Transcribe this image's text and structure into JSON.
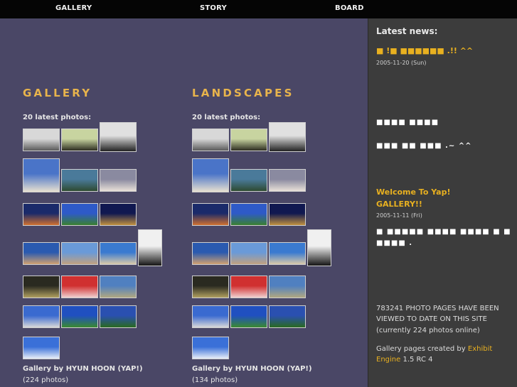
{
  "nav": {
    "items": [
      "GALLERY",
      "STORY",
      "BOARD"
    ]
  },
  "columns": [
    {
      "title": "GALLERY",
      "subtitle": "20 latest photos:",
      "credit_prefix": "Gallery by ",
      "credit_name": "HYUN HOON (YAP!)",
      "count": "(224 photos)"
    },
    {
      "title": "LANDSCAPES",
      "subtitle": "20 latest photos:",
      "credit_prefix": "Gallery by ",
      "credit_name": "HYUN HOON (YAP!)",
      "count": "(134 photos)"
    }
  ],
  "sidebar": {
    "heading": "Latest news:",
    "news": [
      {
        "title": "■ !■ ■■■■■■ .!! ^^",
        "date": "2005-11-20 (Sun)",
        "body": [
          "■■■■ ■■■■",
          "■■■ ■■ ■■■ .~ ^^"
        ]
      },
      {
        "title": "Welcome To Yap! GALLERY!!",
        "date": "2005-11-11 (Fri)",
        "body": [
          "■ ■■■■■ ■■■■ ■■■■ ■ ■",
          "■■■■ ."
        ]
      }
    ],
    "stats": "783241 PHOTO PAGES HAVE BEEN VIEWED TO DATE ON THIS SITE",
    "stats_sub": "(currently 224 photos online)",
    "created_prefix": "Gallery pages created by ",
    "created_link": "Exhibit Engine",
    "created_suffix": " 1.5 RC 4"
  },
  "thumbs": [
    {
      "row": 0,
      "i": 0,
      "icon": "city-bw-photo",
      "colors": [
        "#d8d8d8",
        "#5a5a5a"
      ]
    },
    {
      "row": 0,
      "i": 1,
      "icon": "cafe-photo",
      "colors": [
        "#c8d4a0",
        "#2d2d20"
      ]
    },
    {
      "row": 0,
      "i": 2,
      "icon": "arch-bw-photo",
      "colors": [
        "#e0e0e0",
        "#222222"
      ]
    },
    {
      "row": 1,
      "i": 0,
      "icon": "people-photo",
      "colors": [
        "#4a74c8",
        "#e8e0d0"
      ]
    },
    {
      "row": 1,
      "i": 1,
      "icon": "village-photo",
      "colors": [
        "#4a7a9a",
        "#2e4a30"
      ]
    },
    {
      "row": 1,
      "i": 2,
      "icon": "building-photo",
      "colors": [
        "#8a8aa0",
        "#e8e0d8"
      ]
    },
    {
      "row": 2,
      "i": 0,
      "icon": "night-bridge-photo",
      "colors": [
        "#1a2a6a",
        "#d07030"
      ]
    },
    {
      "row": 2,
      "i": 1,
      "icon": "field-sky-photo",
      "colors": [
        "#2e5ac8",
        "#3a8030"
      ]
    },
    {
      "row": 2,
      "i": 2,
      "icon": "night-museum-photo",
      "colors": [
        "#101850",
        "#c09040"
      ]
    },
    {
      "row": 3,
      "i": 0,
      "icon": "harbor-photo",
      "colors": [
        "#2a5ab0",
        "#d0a070"
      ]
    },
    {
      "row": 3,
      "i": 1,
      "icon": "town-sky-photo",
      "colors": [
        "#6a9ad8",
        "#c0a080"
      ]
    },
    {
      "row": 3,
      "i": 2,
      "icon": "plaza-photo",
      "colors": [
        "#3a7ad0",
        "#d8c8a8"
      ]
    },
    {
      "row": 3,
      "i": 3,
      "icon": "silhouette-bw-photo",
      "colors": [
        "#f0f0f0",
        "#151515"
      ]
    },
    {
      "row": 4,
      "i": 0,
      "icon": "palace-photo",
      "colors": [
        "#2a2a20",
        "#b0a060"
      ]
    },
    {
      "row": 4,
      "i": 1,
      "icon": "red-facade-photo",
      "colors": [
        "#d03030",
        "#f0d0d0"
      ]
    },
    {
      "row": 4,
      "i": 2,
      "icon": "ruins-photo",
      "colors": [
        "#5080c0",
        "#b0a880"
      ]
    },
    {
      "row": 5,
      "i": 0,
      "icon": "lake-city-photo",
      "colors": [
        "#3a6ad0",
        "#d8d8d8"
      ]
    },
    {
      "row": 5,
      "i": 1,
      "icon": "mountain-meadow-photo",
      "colors": [
        "#2050c0",
        "#3a8a30"
      ]
    },
    {
      "row": 5,
      "i": 2,
      "icon": "garden-house-photo",
      "colors": [
        "#2a50b0",
        "#2a6a20"
      ]
    },
    {
      "row": 6,
      "i": 0,
      "icon": "snow-mountain-photo",
      "colors": [
        "#3a70d8",
        "#e8eef8"
      ]
    }
  ]
}
